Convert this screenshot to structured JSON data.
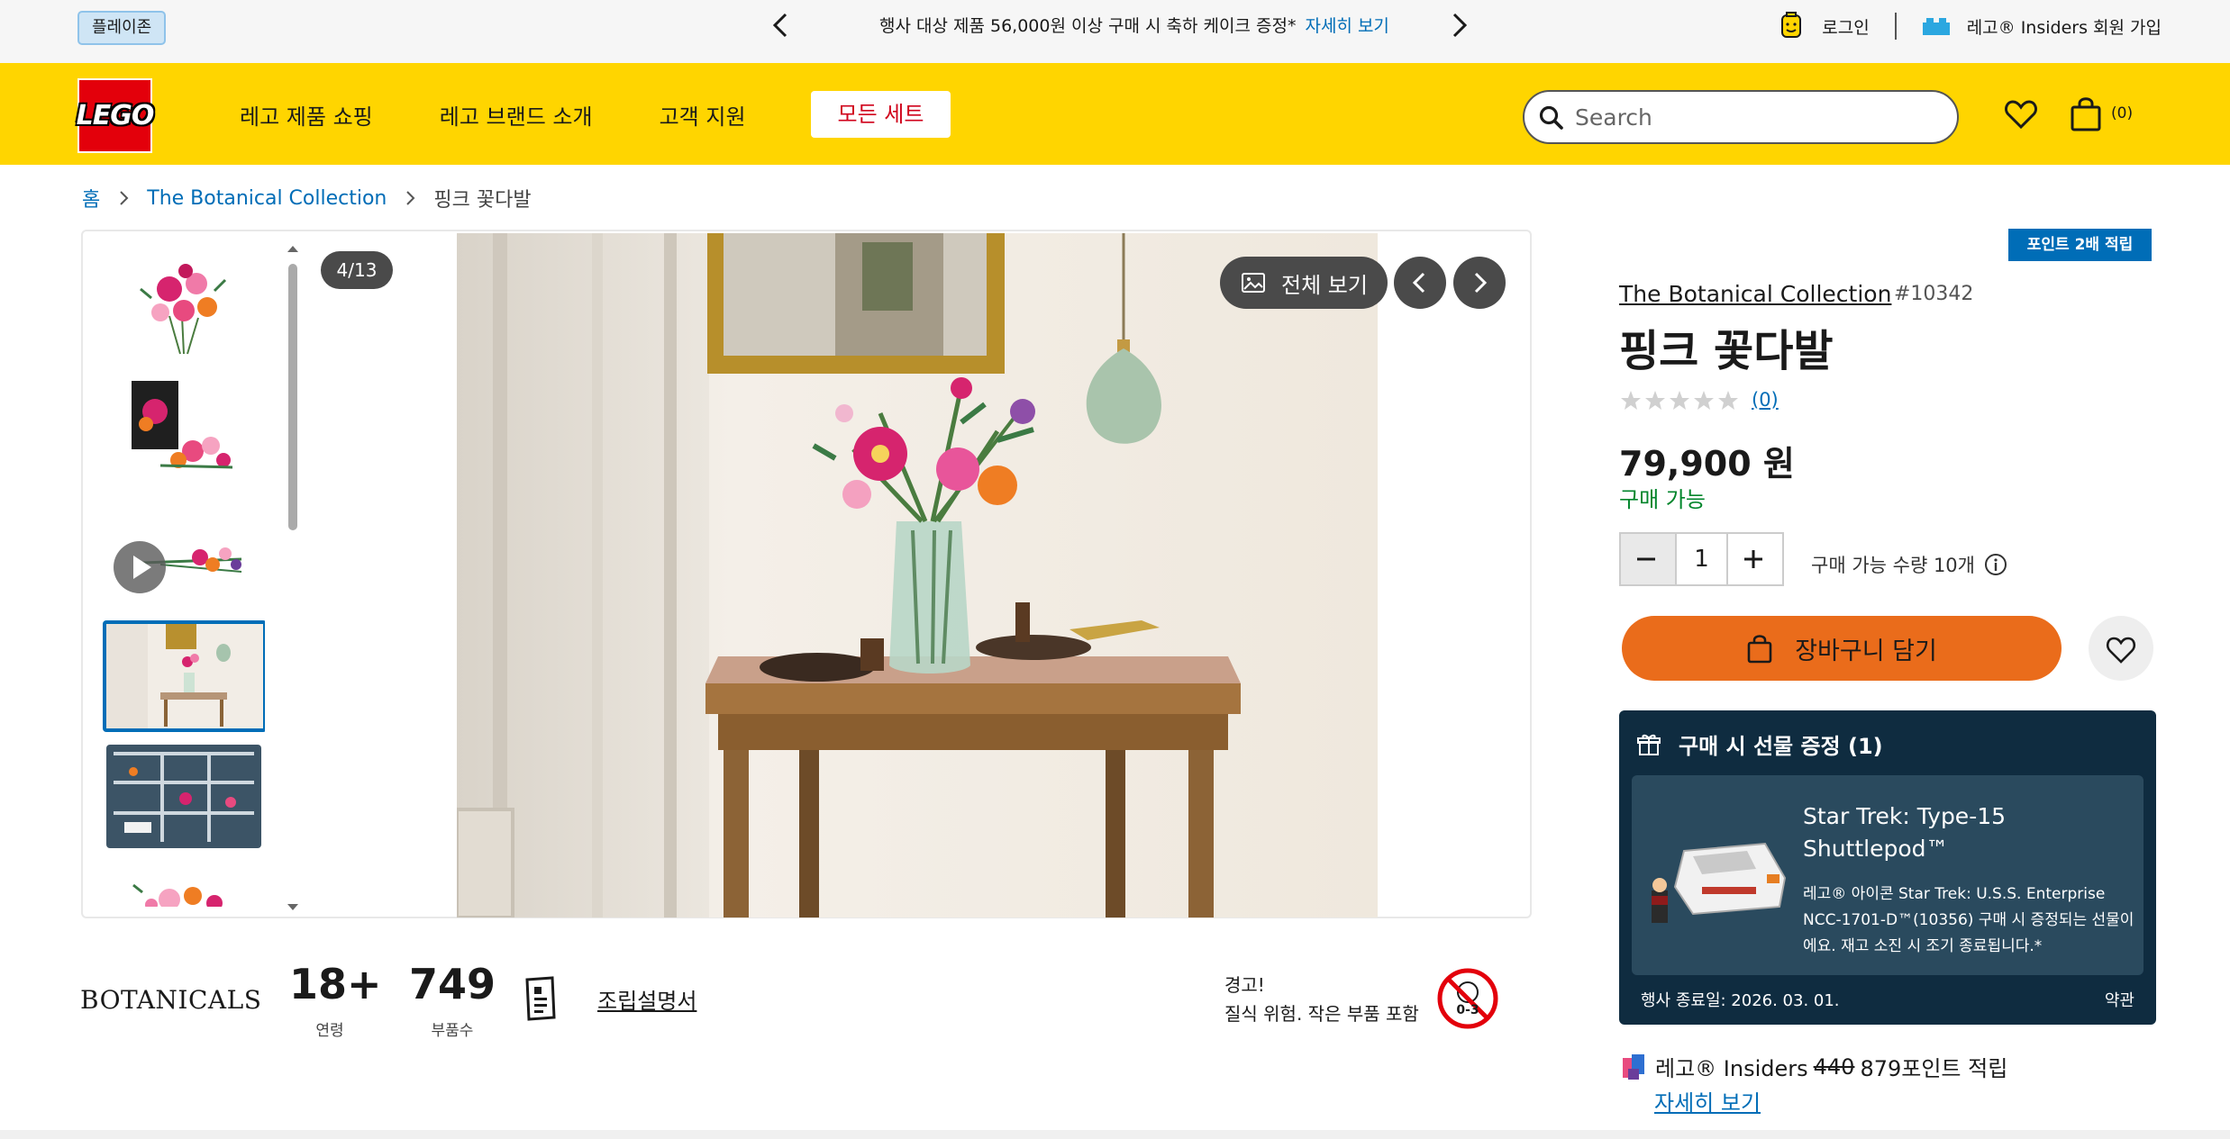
{
  "promo": {
    "playzone": "플레이존",
    "message": "행사 대상 제품 56,000원 이상 구매 시 축하 케이크 증정*",
    "link": "자세히 보기",
    "login": "로그인",
    "insiders_join": "레고® Insiders 회원 가입"
  },
  "header": {
    "logo_text": "LEGO",
    "nav": [
      "레고 제품 쇼핑",
      "레고 브랜드 소개",
      "고객 지원"
    ],
    "all_sets": "모든 세트",
    "search_placeholder": "Search",
    "bag_count": "(0)"
  },
  "breadcrumb": {
    "home": "홈",
    "collection": "The Botanical Collection",
    "current": "핑크 꽃다발"
  },
  "gallery": {
    "counter": "4/13",
    "full_view": "전체 보기",
    "active_index": 4,
    "thumbnail_count": 6
  },
  "specs": {
    "brand_logo": "BOTANICALS",
    "age_value": "18+",
    "age_label": "연령",
    "pieces_value": "749",
    "pieces_label": "부품수",
    "manual": "조립설명서",
    "warning_title": "경고!",
    "warning_body": "질식 위험. 작은 부품 포함",
    "warning_icon_text": "0-3"
  },
  "product": {
    "points_badge": "포인트 2배 적립",
    "collection": "The Botanical Collection",
    "item_number": "#10342",
    "title": "핑크 꽃다발",
    "rating_stars": 0,
    "rating_count": "(0)",
    "price": "79,900 원",
    "availability": "구매 가능",
    "quantity": "1",
    "limit": "구매 가능 수량 10개",
    "add_to_bag": "장바구니 담기"
  },
  "gift": {
    "heading": "구매 시 선물 증정 (1)",
    "name": "Star Trek: Type-15 Shuttlepod™",
    "desc": "레고® 아이콘 Star Trek: U.S.S. Enterprise NCC-1701-D™(10356) 구매 시 증정되는 선물이에요. 재고 소진 시 조기 종료됩니다.*",
    "end_date": "행사 종료일: 2026. 03. 01.",
    "terms": "약관"
  },
  "insiders": {
    "label": "레고® Insiders",
    "old_points": "440",
    "new_points": "879포인트 적립",
    "more": "자세히 보기"
  },
  "colors": {
    "lego_yellow": "#ffd500",
    "lego_red": "#e3000b",
    "link_blue": "#006db7",
    "cart_orange": "#ea6c1b",
    "available_green": "#00852b",
    "gift_navy": "#0f2c40"
  }
}
